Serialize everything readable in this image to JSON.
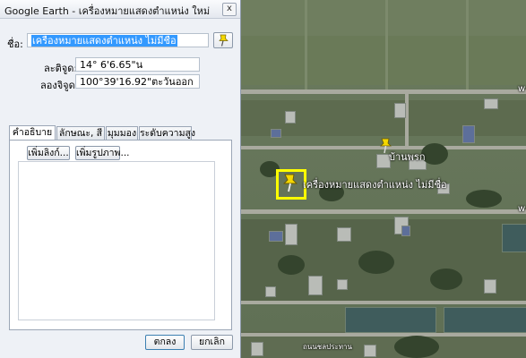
{
  "dialog": {
    "title": "Google Earth - เครื่องหมายแสดงตำแหน่ง ใหม่",
    "close_label": "x",
    "name_label": "ชื่อ:",
    "name_value": "เครื่องหมายแสดงตำแหน่ง ไม่มีชื่อ",
    "latitude_label": "ละติจูด:",
    "latitude_value": "14° 6'6.65\"น",
    "longitude_label": "ลองจิจูด:",
    "longitude_value": "100°39'16.92\"ตะวันออก",
    "tabs": [
      {
        "label": "คำอธิบาย"
      },
      {
        "label": "ลักษณะ, สี"
      },
      {
        "label": "มุมมอง"
      },
      {
        "label": "ระดับความสูง"
      }
    ],
    "add_link_label": "เพิ่มลิงก์...",
    "add_image_label": "เพิ่มรูปภาพ...",
    "ok_label": "ตกลง",
    "cancel_label": "ยกเลิก"
  },
  "map": {
    "placemark_label": "เครื่องหมายแสดงตำแหน่ง ไม่มีชื่อ",
    "place_label_1": "บ้านพรก",
    "edge_label_1": "w",
    "edge_label_2": "w",
    "bottom_label": "ถนนชลประทาน"
  },
  "colors": {
    "selection_box": "#ffff00",
    "pin": "#f5d800",
    "name_highlight": "#3399ff"
  }
}
